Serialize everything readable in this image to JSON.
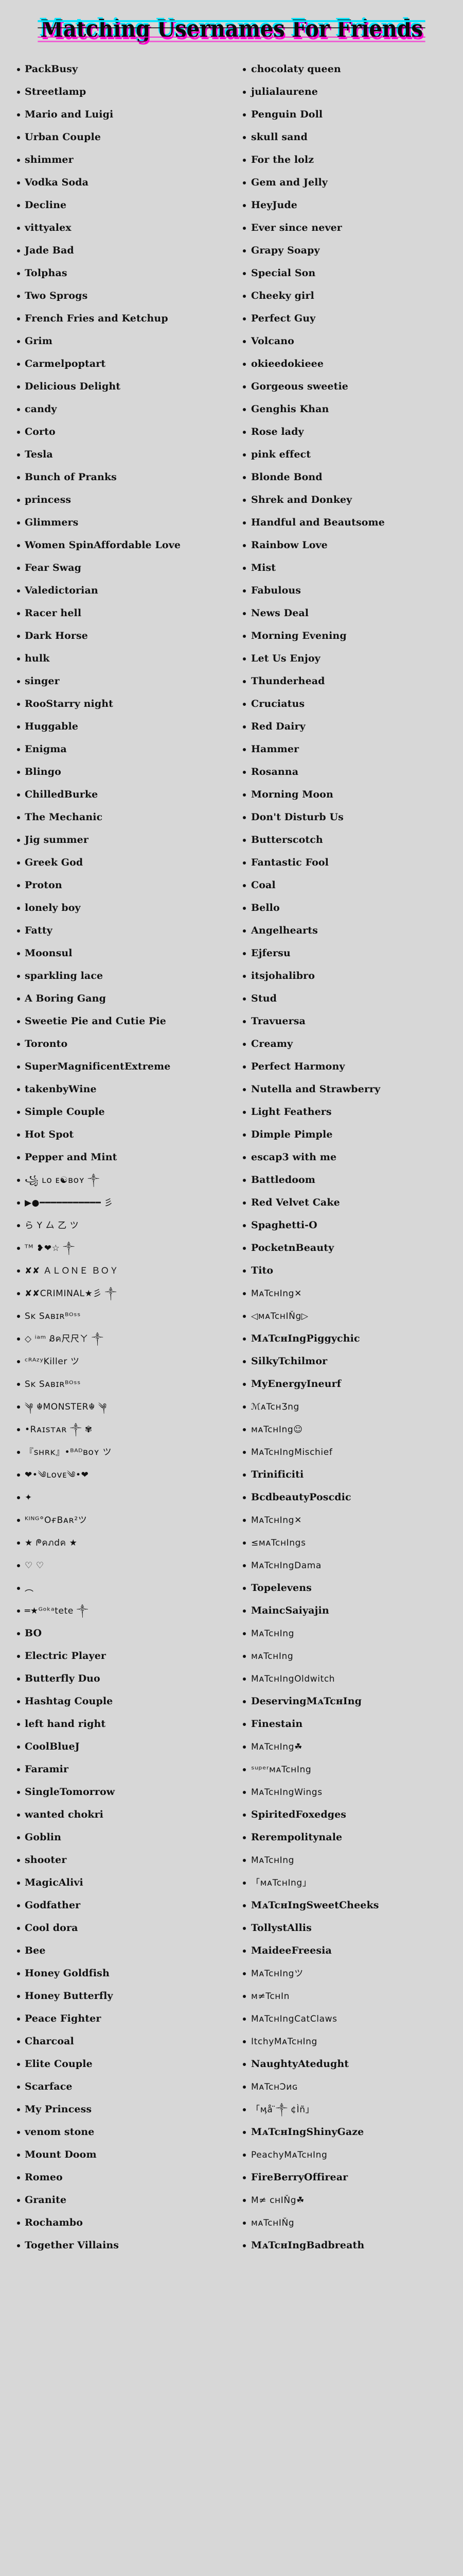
{
  "page": {
    "title": "Matching Usernames For Friends",
    "background_color": "#d7d7d7",
    "text_color": "#111111",
    "glitch_cyan": "#00e5ff",
    "glitch_magenta": "#ff00d0"
  },
  "columns": {
    "left": [
      "PackBusy",
      "Streetlamp",
      "Mario and Luigi",
      "Urban Couple",
      "shimmer",
      "Vodka Soda",
      "Decline",
      "vittyalex",
      "Jade Bad",
      "Tolphas",
      "Two Sprogs",
      "French Fries and Ketchup",
      "Grim",
      "Carmelpoptart",
      "Delicious Delight",
      "candy",
      "Corto",
      "Tesla",
      "Bunch of Pranks",
      "princess",
      "Glimmers",
      "Women SpinAffordable Love",
      "Fear Swag",
      "Valedictorian",
      "Racer hell",
      "Dark Horse",
      "hulk",
      "singer",
      "RooStarry night",
      "Huggable",
      "Enigma",
      "Blingo",
      "ChilledBurke",
      "The Mechanic",
      "Jig summer",
      "Greek God",
      "Proton",
      "lonely boy",
      "Fatty",
      "Moonsul",
      "sparkling lace",
      "A Boring Gang",
      "Sweetie Pie and Cutie Pie",
      "Toronto",
      "SuperMagnificentExtreme",
      "takenbyWine",
      "Simple Couple",
      "Hot Spot",
      "Pepper and Mint",
      "꧁ ʟᴏ ᴇ☯ʙᴏʏ ༒",
      "▶●━━━━━━━━━━━ 彡",
      "ら Ү 厶 乙 ツ",
      "ᵀᴹ ❥❤☆ ༒",
      "✘✘ ＡＬＯＮＥ ＢＯＹ",
      "✘✘CRIMINAL★彡 ༒",
      "Sᴋ Sᴀʙɪʀᴮᴼˢˢ",
      "◇ ⁱᵃᵐ Ᏸค尺尺ㄚ ༒",
      "ᶜᴿᴬᶻʸKiller ツ",
      "Sᴋ Sᴀʙɪʀᴮᴼˢˢ",
      "༆ ☬MONSTER☬ ༆",
      "•Rᴀɪsᴛᴀʀ ༒ ✾",
      "『sʜʀᴋ』•ᴮᴬᴰʙᴏʏ ツ",
      "❤•༄ʟᴏᴠᴇ༄•❤",
      "✦",
      "ᴷᴵᴺᴳ°OғBᴀʀ²ツ",
      "★ ᖘคภdค ★",
      "♡        ♡",
      "︵",
      "═★ᴳᵒᵏᵃtete ༒",
      "BO",
      "Electric Player",
      "Butterfly Duo",
      "Hashtag Couple",
      "left hand right",
      "CoolBlueJ",
      "Faramir",
      "SingleTomorrow",
      "wanted chokri",
      "Goblin",
      "shooter",
      "MagicAlivi",
      "Godfather",
      "Cool dora",
      "Bee",
      "Honey Goldfish",
      "Honey Butterfly",
      "Peace Fighter",
      "Charcoal",
      "Elite Couple",
      "Scarface",
      "My Princess",
      "venom stone",
      "Mount Doom",
      "Romeo",
      "Granite",
      "Rochambo",
      "Together Villains"
    ],
    "right": [
      "chocolaty queen",
      "julialaurene",
      "Penguin Doll",
      "skull sand",
      "For the lolz",
      "Gem and Jelly",
      "HeyJude",
      "Ever since never",
      "Grapy Soapy",
      "Special Son",
      "Cheeky girl",
      "Perfect Guy",
      "Volcano",
      "okieedokieee",
      "Gorgeous sweetie",
      "Genghis Khan",
      "Rose lady",
      "pink effect",
      "Blonde Bond",
      "Shrek and Donkey",
      "Handful and Beautsome",
      "Rainbow Love",
      "Mist",
      "Fabulous",
      "News Deal",
      "Morning Evening",
      "Let Us Enjoy",
      "Thunderhead",
      "Cruciatus",
      "Red Dairy",
      "Hammer",
      "Rosanna",
      "Morning Moon",
      "Don't Disturb Us",
      "Butterscotch",
      "Fantastic Fool",
      "Coal",
      "Bello",
      "Angelhearts",
      "Ejfersu",
      "itsjohalibro",
      "Stud",
      "Travuersa",
      "Creamy",
      "Perfect Harmony",
      "Nutella and Strawberry",
      "Light Feathers",
      "Dimple Pimple",
      "escap3 with me",
      "Battledoom",
      "Red Velvet Cake",
      "Spaghetti-O",
      "PocketnBeauty",
      "Tito",
      "MᴀTcʜIng✕",
      "◁мᴀTcʜIŇg▷",
      "MᴀTcʜIngPiggychic",
      "SilkyTchilmor",
      "MyEnergyIneurf",
      "ℳᴀTcʜƷng",
      "мᴀTcʜIng☺",
      "MᴀTcʜIngMischief",
      "Trinificiti",
      "BcdbeautyPoscdic",
      "MᴀTcʜIng✕",
      "≤мᴀTcʜIngs",
      "MᴀTcʜIngDama",
      "Topelevens",
      "MaincSaiyajin",
      "MᴀTcʜIng",
      "мᴀTcʜIng",
      "MᴀTcʜIngOldwitch",
      "DeservingMᴀTcʜIng",
      "Finestain",
      "MᴀTcʜIng☘",
      "ˢᵘᵖᵉʳмᴀTcʜIng",
      "MᴀTcʜIngWings",
      "SpiritedFoxedges",
      "Rerempolitynale",
      "MᴀTcʜIng",
      "「мᴀTcʜIng」",
      "MᴀTcʜIngSweetCheeks",
      "TollystAllis",
      "MaideeFreesia",
      "MᴀTcʜIngツ",
      "м≠TcʜIn",
      "MᴀTcʜIngCatClaws",
      "ItchyMᴀTcʜIng",
      "NaughtyAtedught",
      "MᴀTcʜƆᴎɢ",
      "「ӎå ̈༒ ¢Ìñ」",
      "MᴀTcʜIngShinyGaze",
      "PeachyMᴀTcʜIng",
      "FireBerryOffirear",
      "M≠ cʜIŇg☘",
      "мᴀTcʜIŇg",
      "MᴀTcʜIngBadbreath"
    ]
  }
}
